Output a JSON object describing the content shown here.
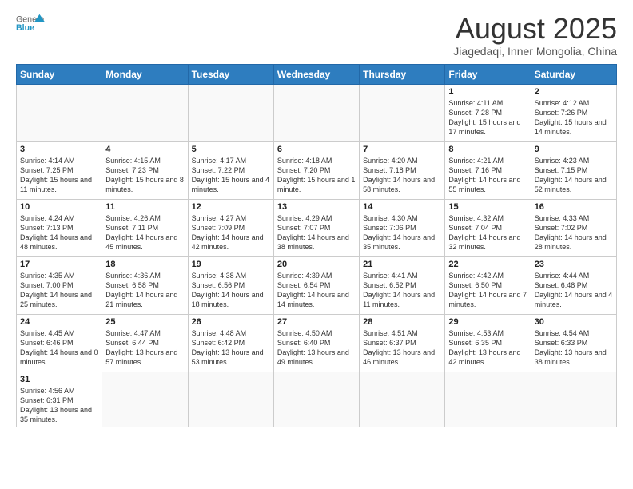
{
  "header": {
    "logo_general": "General",
    "logo_blue": "Blue",
    "month_title": "August 2025",
    "subtitle": "Jiagedaqi, Inner Mongolia, China"
  },
  "weekdays": [
    "Sunday",
    "Monday",
    "Tuesday",
    "Wednesday",
    "Thursday",
    "Friday",
    "Saturday"
  ],
  "weeks": [
    [
      {
        "day": "",
        "info": ""
      },
      {
        "day": "",
        "info": ""
      },
      {
        "day": "",
        "info": ""
      },
      {
        "day": "",
        "info": ""
      },
      {
        "day": "",
        "info": ""
      },
      {
        "day": "1",
        "info": "Sunrise: 4:11 AM\nSunset: 7:28 PM\nDaylight: 15 hours\nand 17 minutes."
      },
      {
        "day": "2",
        "info": "Sunrise: 4:12 AM\nSunset: 7:26 PM\nDaylight: 15 hours\nand 14 minutes."
      }
    ],
    [
      {
        "day": "3",
        "info": "Sunrise: 4:14 AM\nSunset: 7:25 PM\nDaylight: 15 hours\nand 11 minutes."
      },
      {
        "day": "4",
        "info": "Sunrise: 4:15 AM\nSunset: 7:23 PM\nDaylight: 15 hours\nand 8 minutes."
      },
      {
        "day": "5",
        "info": "Sunrise: 4:17 AM\nSunset: 7:22 PM\nDaylight: 15 hours\nand 4 minutes."
      },
      {
        "day": "6",
        "info": "Sunrise: 4:18 AM\nSunset: 7:20 PM\nDaylight: 15 hours\nand 1 minute."
      },
      {
        "day": "7",
        "info": "Sunrise: 4:20 AM\nSunset: 7:18 PM\nDaylight: 14 hours\nand 58 minutes."
      },
      {
        "day": "8",
        "info": "Sunrise: 4:21 AM\nSunset: 7:16 PM\nDaylight: 14 hours\nand 55 minutes."
      },
      {
        "day": "9",
        "info": "Sunrise: 4:23 AM\nSunset: 7:15 PM\nDaylight: 14 hours\nand 52 minutes."
      }
    ],
    [
      {
        "day": "10",
        "info": "Sunrise: 4:24 AM\nSunset: 7:13 PM\nDaylight: 14 hours\nand 48 minutes."
      },
      {
        "day": "11",
        "info": "Sunrise: 4:26 AM\nSunset: 7:11 PM\nDaylight: 14 hours\nand 45 minutes."
      },
      {
        "day": "12",
        "info": "Sunrise: 4:27 AM\nSunset: 7:09 PM\nDaylight: 14 hours\nand 42 minutes."
      },
      {
        "day": "13",
        "info": "Sunrise: 4:29 AM\nSunset: 7:07 PM\nDaylight: 14 hours\nand 38 minutes."
      },
      {
        "day": "14",
        "info": "Sunrise: 4:30 AM\nSunset: 7:06 PM\nDaylight: 14 hours\nand 35 minutes."
      },
      {
        "day": "15",
        "info": "Sunrise: 4:32 AM\nSunset: 7:04 PM\nDaylight: 14 hours\nand 32 minutes."
      },
      {
        "day": "16",
        "info": "Sunrise: 4:33 AM\nSunset: 7:02 PM\nDaylight: 14 hours\nand 28 minutes."
      }
    ],
    [
      {
        "day": "17",
        "info": "Sunrise: 4:35 AM\nSunset: 7:00 PM\nDaylight: 14 hours\nand 25 minutes."
      },
      {
        "day": "18",
        "info": "Sunrise: 4:36 AM\nSunset: 6:58 PM\nDaylight: 14 hours\nand 21 minutes."
      },
      {
        "day": "19",
        "info": "Sunrise: 4:38 AM\nSunset: 6:56 PM\nDaylight: 14 hours\nand 18 minutes."
      },
      {
        "day": "20",
        "info": "Sunrise: 4:39 AM\nSunset: 6:54 PM\nDaylight: 14 hours\nand 14 minutes."
      },
      {
        "day": "21",
        "info": "Sunrise: 4:41 AM\nSunset: 6:52 PM\nDaylight: 14 hours\nand 11 minutes."
      },
      {
        "day": "22",
        "info": "Sunrise: 4:42 AM\nSunset: 6:50 PM\nDaylight: 14 hours\nand 7 minutes."
      },
      {
        "day": "23",
        "info": "Sunrise: 4:44 AM\nSunset: 6:48 PM\nDaylight: 14 hours\nand 4 minutes."
      }
    ],
    [
      {
        "day": "24",
        "info": "Sunrise: 4:45 AM\nSunset: 6:46 PM\nDaylight: 14 hours\nand 0 minutes."
      },
      {
        "day": "25",
        "info": "Sunrise: 4:47 AM\nSunset: 6:44 PM\nDaylight: 13 hours\nand 57 minutes."
      },
      {
        "day": "26",
        "info": "Sunrise: 4:48 AM\nSunset: 6:42 PM\nDaylight: 13 hours\nand 53 minutes."
      },
      {
        "day": "27",
        "info": "Sunrise: 4:50 AM\nSunset: 6:40 PM\nDaylight: 13 hours\nand 49 minutes."
      },
      {
        "day": "28",
        "info": "Sunrise: 4:51 AM\nSunset: 6:37 PM\nDaylight: 13 hours\nand 46 minutes."
      },
      {
        "day": "29",
        "info": "Sunrise: 4:53 AM\nSunset: 6:35 PM\nDaylight: 13 hours\nand 42 minutes."
      },
      {
        "day": "30",
        "info": "Sunrise: 4:54 AM\nSunset: 6:33 PM\nDaylight: 13 hours\nand 38 minutes."
      }
    ],
    [
      {
        "day": "31",
        "info": "Sunrise: 4:56 AM\nSunset: 6:31 PM\nDaylight: 13 hours\nand 35 minutes."
      },
      {
        "day": "",
        "info": ""
      },
      {
        "day": "",
        "info": ""
      },
      {
        "day": "",
        "info": ""
      },
      {
        "day": "",
        "info": ""
      },
      {
        "day": "",
        "info": ""
      },
      {
        "day": "",
        "info": ""
      }
    ]
  ]
}
